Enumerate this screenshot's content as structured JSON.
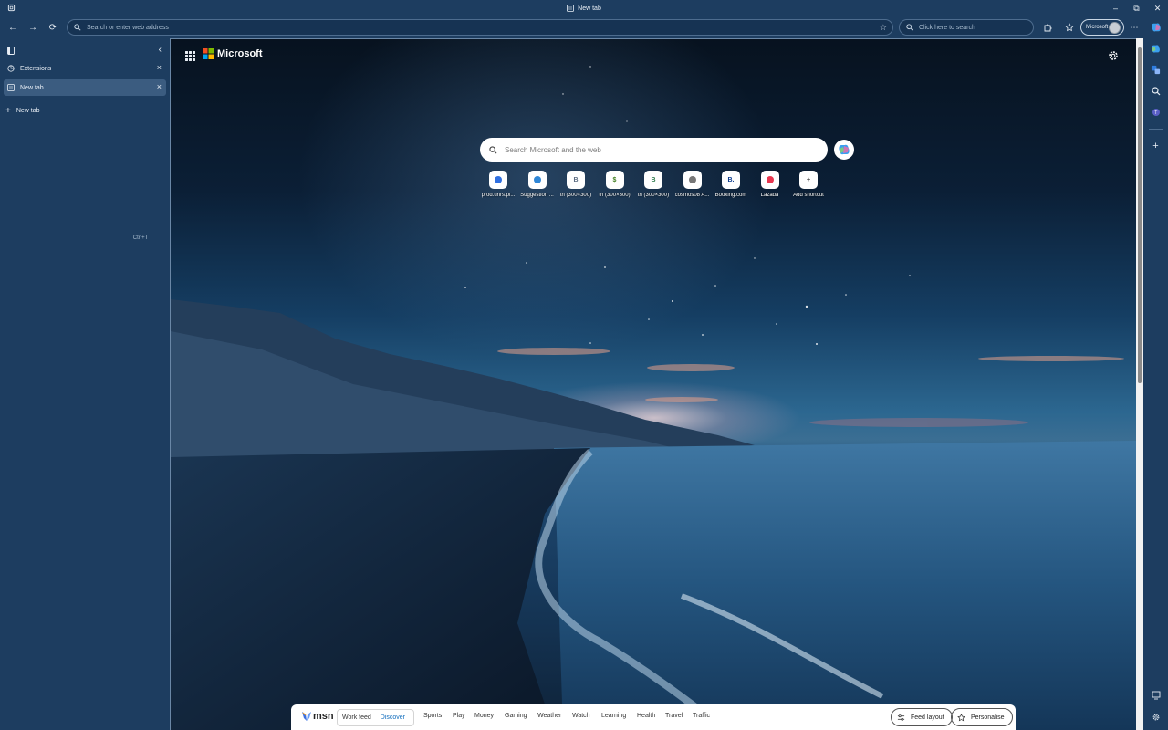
{
  "window": {
    "title": "New tab"
  },
  "toolbar": {
    "address_placeholder": "Search or enter web address",
    "search_placeholder": "Click here to search",
    "profile_label": "Microsoft"
  },
  "sidepanel": {
    "tabs": [
      {
        "label": "Extensions"
      },
      {
        "label": "New tab"
      }
    ],
    "new_tab": {
      "label": "New tab",
      "shortcut": "Ctrl+T"
    }
  },
  "newtab": {
    "brand": "Microsoft",
    "search_placeholder": "Search Microsoft and the web",
    "shortcuts": [
      {
        "label": "prod.uhrs.pl...",
        "glyph": "",
        "color": "#2f6fe0"
      },
      {
        "label": "Suggestion ...",
        "glyph": "",
        "color": "#2f86d6"
      },
      {
        "label": "th (300×300)",
        "glyph": "B",
        "color": "#5a6c82"
      },
      {
        "label": "th (300×300)",
        "glyph": "$",
        "color": "#3f7d1f"
      },
      {
        "label": "th (300×300)",
        "glyph": "B",
        "color": "#2c7a4b"
      },
      {
        "label": "cosmos08 A...",
        "glyph": "",
        "color": "#777777"
      },
      {
        "label": "Booking.com",
        "glyph": "B.",
        "color": "#0b3a8c"
      },
      {
        "label": "Lazada",
        "glyph": "",
        "color": "#e8364f"
      },
      {
        "label": "Add shortcut",
        "glyph": "+",
        "color": "#555555"
      }
    ]
  },
  "msn": {
    "brand": "msn",
    "feed_options": [
      "Work feed",
      "Discover"
    ],
    "nav": [
      "Sports",
      "Play",
      "Money",
      "Gaming",
      "Weather",
      "Watch",
      "Learning",
      "Health",
      "Travel",
      "Traffic"
    ],
    "feed_layout": "Feed layout",
    "personalise": "Personalise"
  }
}
